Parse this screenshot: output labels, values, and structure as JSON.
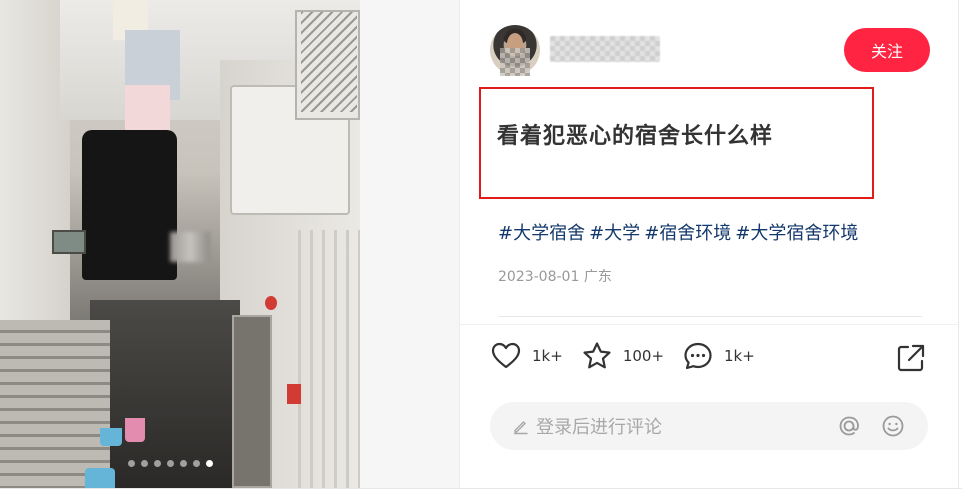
{
  "image_panel": {
    "dot_count": 7,
    "active_dot": 6
  },
  "author": {
    "username": "",
    "follow_label": "关注"
  },
  "note": {
    "title": "看着犯恶心的宿舍长什么样",
    "tags": [
      "#大学宿舍",
      "#大学",
      "#宿舍环境",
      "#大学宿舍环境"
    ],
    "date": "2023-08-01",
    "location": "广东"
  },
  "stats": {
    "likes": "1k+",
    "collects": "100+",
    "comments": "1k+"
  },
  "comment_input": {
    "placeholder": "登录后进行评论"
  },
  "colors": {
    "accent": "#ff2442",
    "tag": "#13386c",
    "highlight_box": "#e21b1b"
  },
  "icons": [
    "heart-icon",
    "star-icon",
    "comment-bubble-icon",
    "share-icon",
    "pen-icon",
    "at-icon",
    "emoji-icon"
  ]
}
